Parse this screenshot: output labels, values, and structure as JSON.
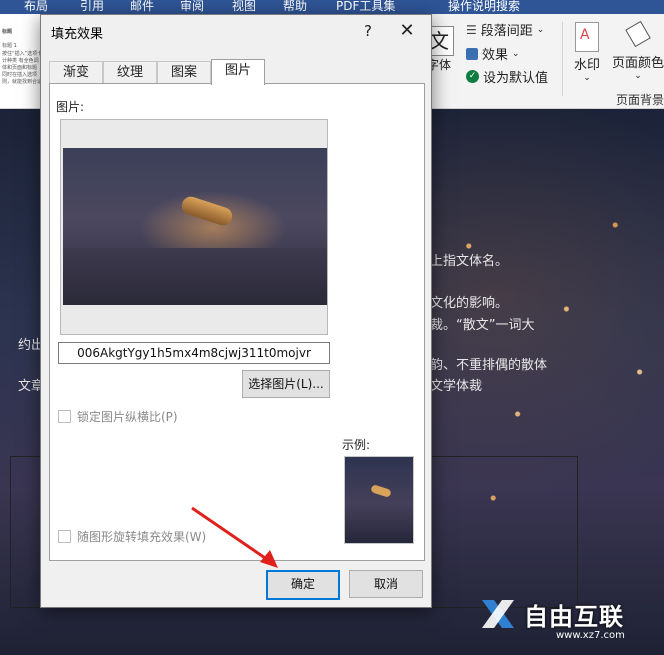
{
  "titlebar": {
    "items": [
      "布局",
      "引用",
      "邮件",
      "审阅",
      "视图",
      "帮助",
      "PDF工具集",
      "操作说明搜索"
    ]
  },
  "ribbon": {
    "font_label": "字体",
    "para_spacing": "段落间距",
    "effects": "效果",
    "set_default": "设为默认值",
    "watermark": "水印",
    "page_color": "页面颜色",
    "page_bg_group": "页面背景",
    "doc_thumb_lines": [
      "标题",
      "标题 1",
      "按住“插入”选项卡",
      "计种类 有全色调",
      "体和页面和标题",
      "同时在插入选项",
      "则，就能找到合适"
    ]
  },
  "document": {
    "lines": [
      {
        "text": "上指文体名。"
      },
      {
        "text": "文化的影响。"
      },
      {
        "text": "裁。“散文”一词大"
      },
      {
        "text": "约出"
      },
      {
        "text": "韵、不重排偶的散体"
      },
      {
        "text": "文章"
      },
      {
        "text": "文学体裁"
      }
    ]
  },
  "dialog": {
    "title": "填充效果",
    "help": "?",
    "close": "✕",
    "tabs": [
      {
        "label": "渐变",
        "active": false
      },
      {
        "label": "纹理",
        "active": false
      },
      {
        "label": "图案",
        "active": false
      },
      {
        "label": "图片",
        "active": true
      }
    ],
    "picture_label": "图片:",
    "filename": "006AkgtYgy1h5mx4m8cjwj311t0mojvr",
    "select_button": "选择图片(L)...",
    "lock_aspect": "锁定图片纵横比(P)",
    "sample_label": "示例:",
    "rotate_with_shape": "随图形旋转填充效果(W)",
    "ok": "确定",
    "cancel": "取消"
  },
  "watermark": {
    "brand": "自由互联",
    "url": "www.xz7.com"
  },
  "colors": {
    "ribbon_bg": "#f3f3f3",
    "title_bar": "#2f5597",
    "accent_blue": "#0078d7",
    "arrow_red": "#e0201c"
  }
}
